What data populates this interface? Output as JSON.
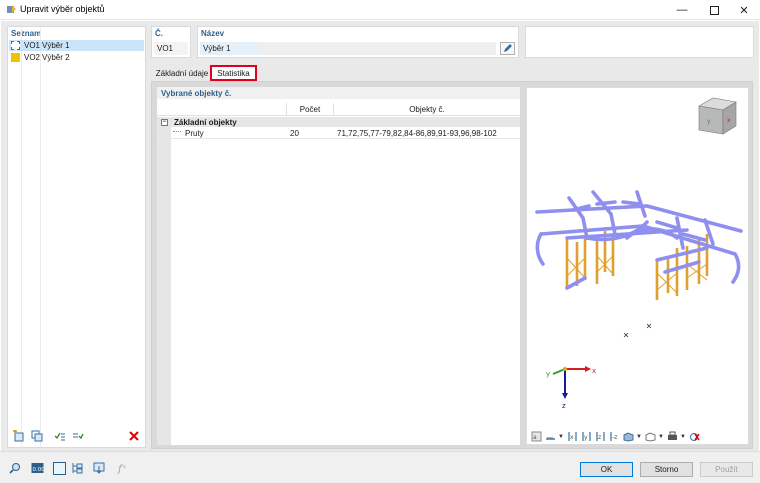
{
  "window": {
    "title": "Upravit výběr objektů",
    "icon": "app-icon",
    "controls": [
      "minimize-icon",
      "maximize-icon",
      "close-icon"
    ]
  },
  "left_panel": {
    "caption": "Seznam",
    "items": [
      {
        "num": "VO1",
        "name": "Výběr 1",
        "color": "#ffffff",
        "selected": true
      },
      {
        "num": "VO2",
        "name": "Výběr 2",
        "color": "#f2c100",
        "selected": false
      }
    ]
  },
  "form": {
    "number_label": "Č.",
    "number_value": "VO1",
    "name_label": "Název",
    "name_value": "Výběr 1"
  },
  "tabs": [
    {
      "label": "Základní údaje",
      "active": false
    },
    {
      "label": "Statistika",
      "active": true
    }
  ],
  "statistics": {
    "caption": "Vybrané objekty č.",
    "columns": [
      "",
      "Počet",
      "Objekty č."
    ],
    "group": {
      "label": "Základní objekty",
      "expander": "−"
    },
    "rows": [
      {
        "label": "Pruty",
        "count": "20",
        "objects": "71,72,75,77-79,82,84-86,89,91-93,96,98-102"
      }
    ]
  },
  "view": {
    "axes": {
      "x": "x",
      "y": "y",
      "z": "z"
    },
    "colors": {
      "beam": "#8f8ff0",
      "column": "#e0a030"
    }
  },
  "buttons": {
    "ok": "OK",
    "cancel": "Storno",
    "apply": "Použít"
  },
  "colors": {
    "accent": "#2e5f8c",
    "highlight": "#e3001b",
    "selection": "#cce4f7"
  }
}
